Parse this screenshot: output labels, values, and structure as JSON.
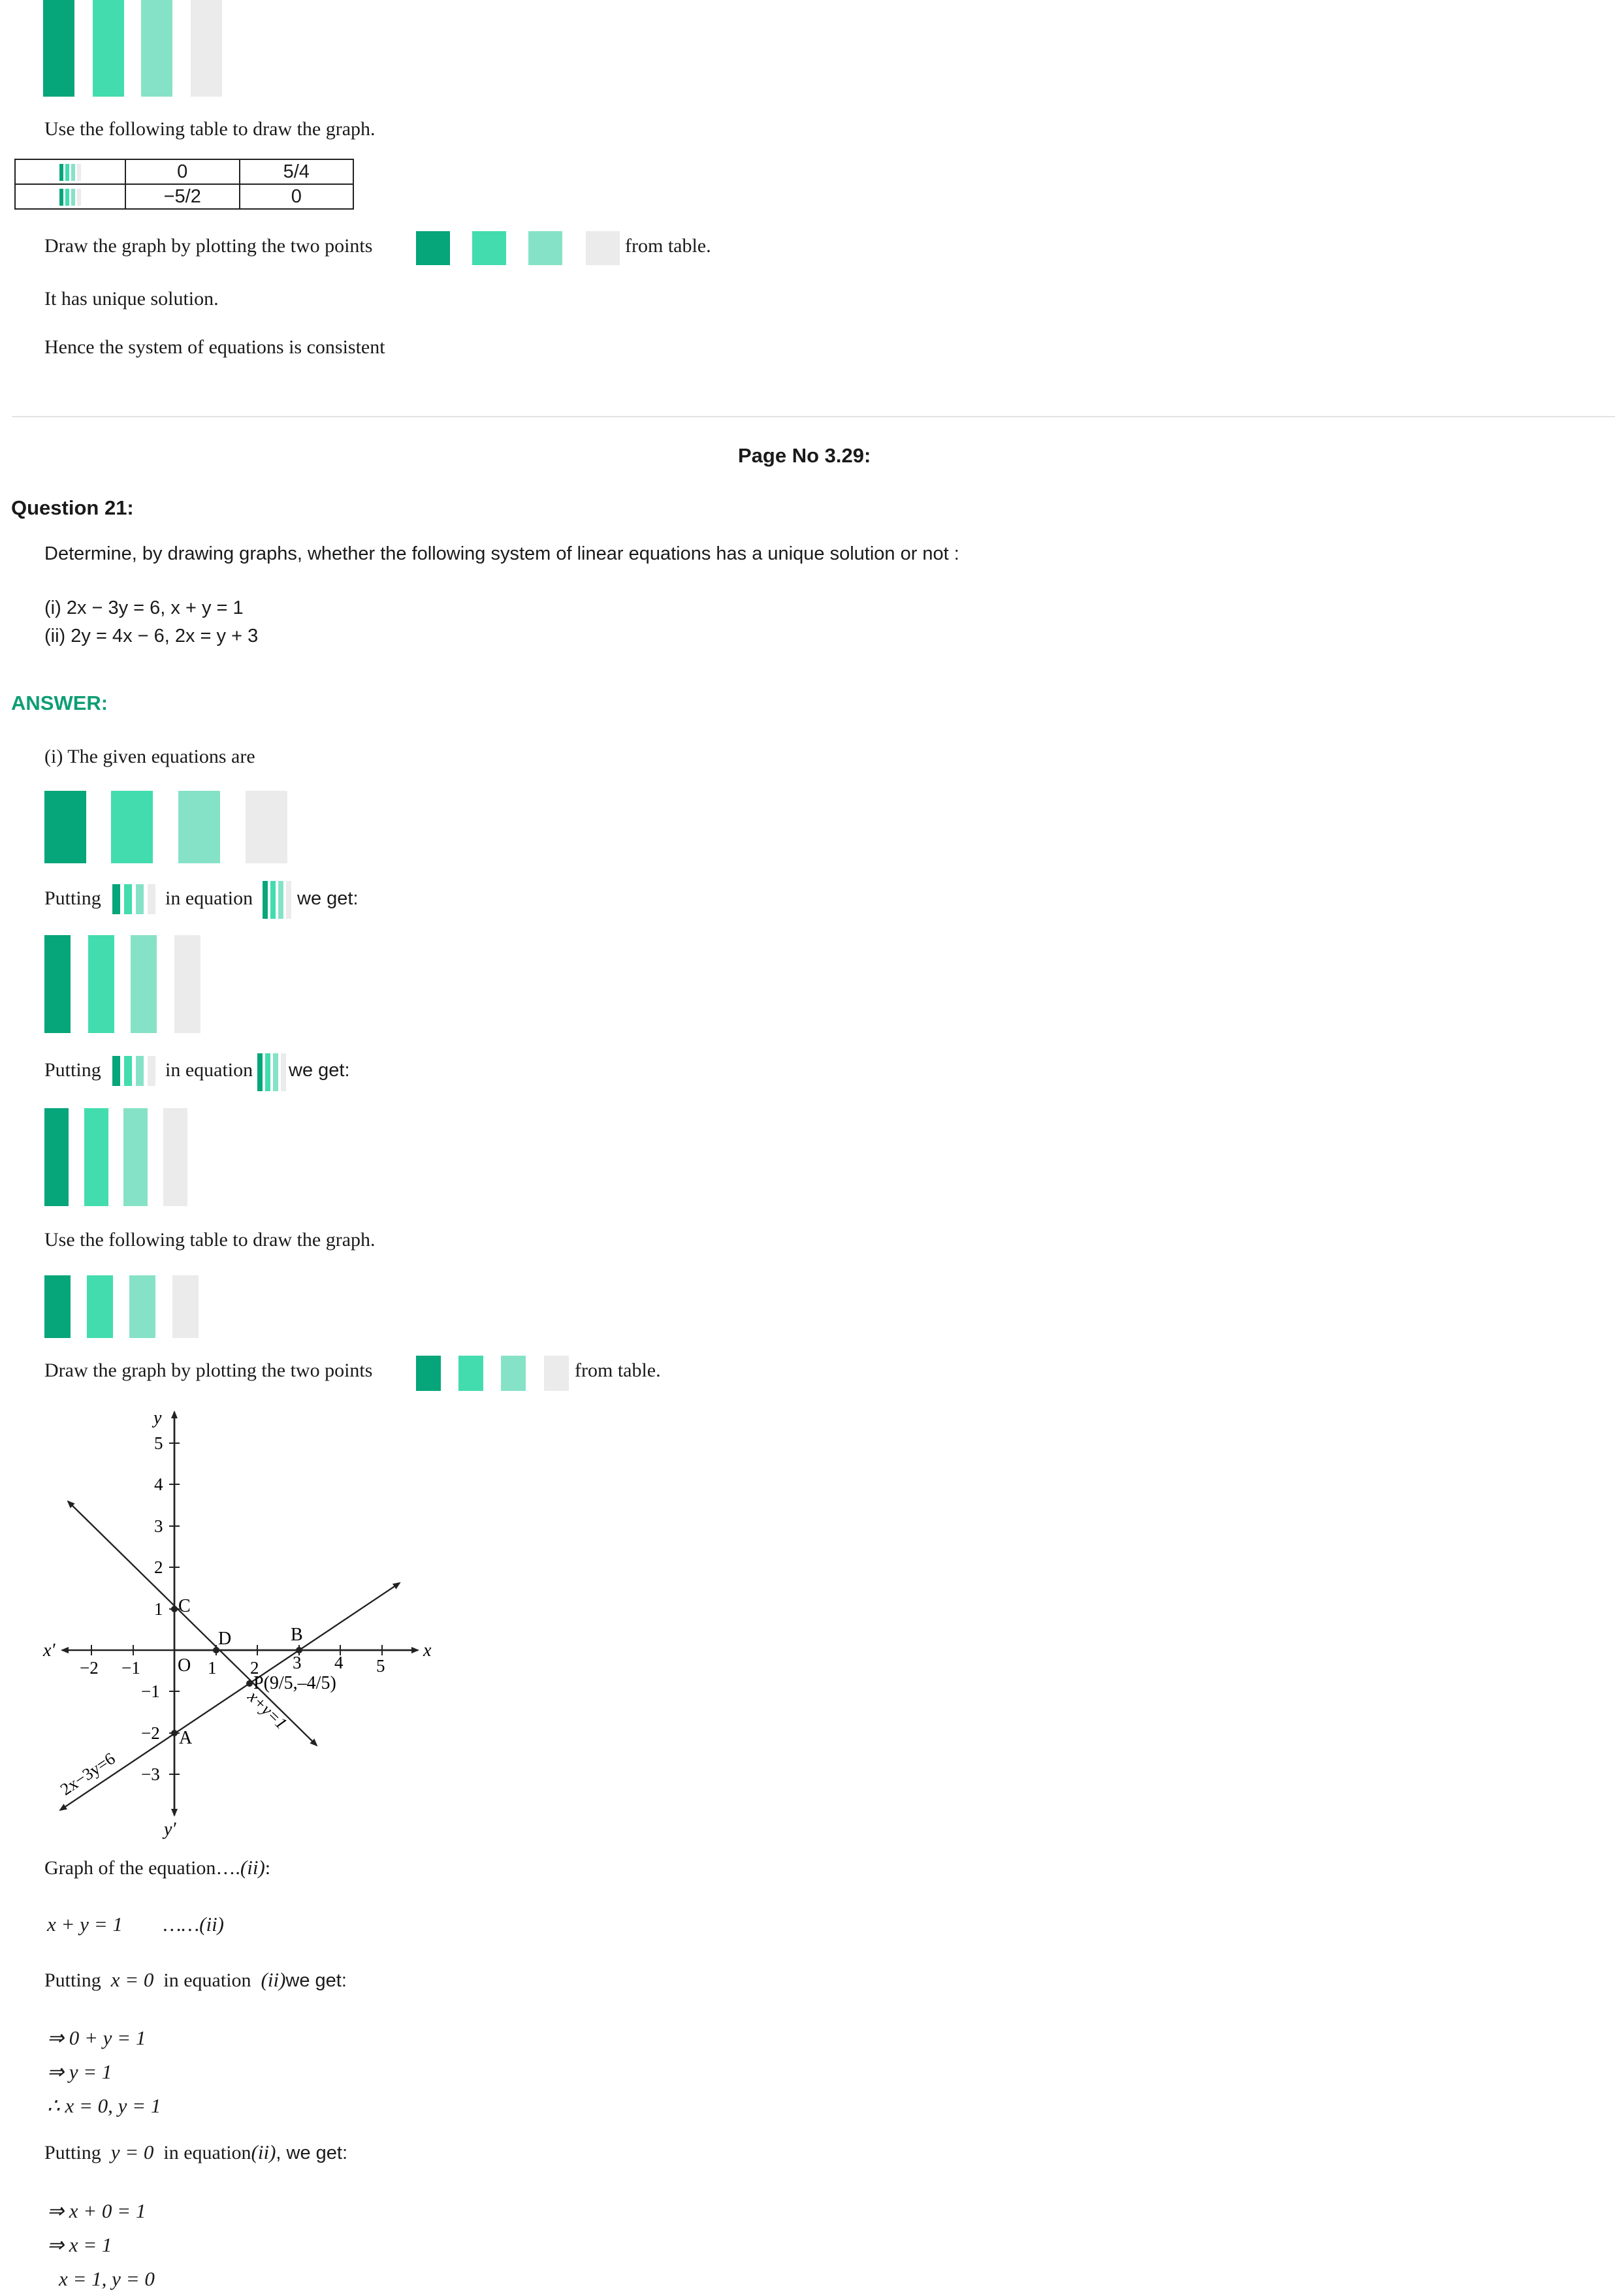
{
  "top": {
    "line1": "Use the following table to draw the graph.",
    "table": {
      "rows": [
        [
          "0",
          "5/4"
        ],
        [
          "−5/2",
          "0"
        ]
      ]
    },
    "draw_prefix": "Draw the graph by plotting the two points",
    "draw_suffix": "from table.",
    "unique": "It has unique solution.",
    "consistent": "Hence the system of equations is consistent"
  },
  "page_no": "Page No 3.29:",
  "question": {
    "title": "Question 21:",
    "prompt": "Determine, by drawing graphs, whether the following system of linear equations has a unique solution or not :",
    "part1": "(i) 2x − 3y = 6, x + y = 1",
    "part2": "(ii) 2y = 4x − 6, 2x = y + 3"
  },
  "answer": {
    "heading": "ANSWER:",
    "given": "(i) The given equations are",
    "putting": "Putting",
    "in_equation": "in equation",
    "we_get": "we get:",
    "use_table": "Use the following table to draw the graph.",
    "draw_prefix": "Draw the graph by plotting the two points",
    "draw_suffix": "from table."
  },
  "graph": {
    "x_axis": "x",
    "x_axis_neg": "x′",
    "y_axis": "y",
    "y_axis_neg": "y′",
    "x_ticks": [
      "−2",
      "−1",
      "1",
      "2",
      "3",
      "4",
      "5"
    ],
    "y_ticks": [
      "5",
      "4",
      "3",
      "2",
      "1",
      "−1",
      "−2",
      "−3"
    ],
    "origin": "O",
    "labels": {
      "C": "C",
      "D": "D",
      "B": "B",
      "A": "A",
      "P": "P(9/5,–4/5)",
      "line1": "2x−3y=6",
      "line2": "x+y=1"
    }
  },
  "section2": {
    "graph_of": "Graph of the equation….",
    "eq_ref": "(ii)",
    "colon": ":",
    "eq": "x + y = 1",
    "eq_tag": "……(ii)",
    "putting": "Putting",
    "x0": "x = 0",
    "y0": "y = 0",
    "in_equation": "in equation",
    "we_get": "we get:",
    "we_get_comma": ", we get:",
    "steps1": [
      "⇒ 0 + y = 1",
      "⇒ y = 1",
      "∴ x = 0,   y = 1"
    ],
    "steps2": [
      "⇒ x + 0 = 1",
      "⇒ x = 1",
      "x = 1,   y = 0"
    ]
  },
  "colors": {
    "dark": "#06a57a",
    "mid": "#43dcae",
    "light": "#86e2c6",
    "grey": "#ebebeb",
    "answer": "#0e9e73"
  }
}
